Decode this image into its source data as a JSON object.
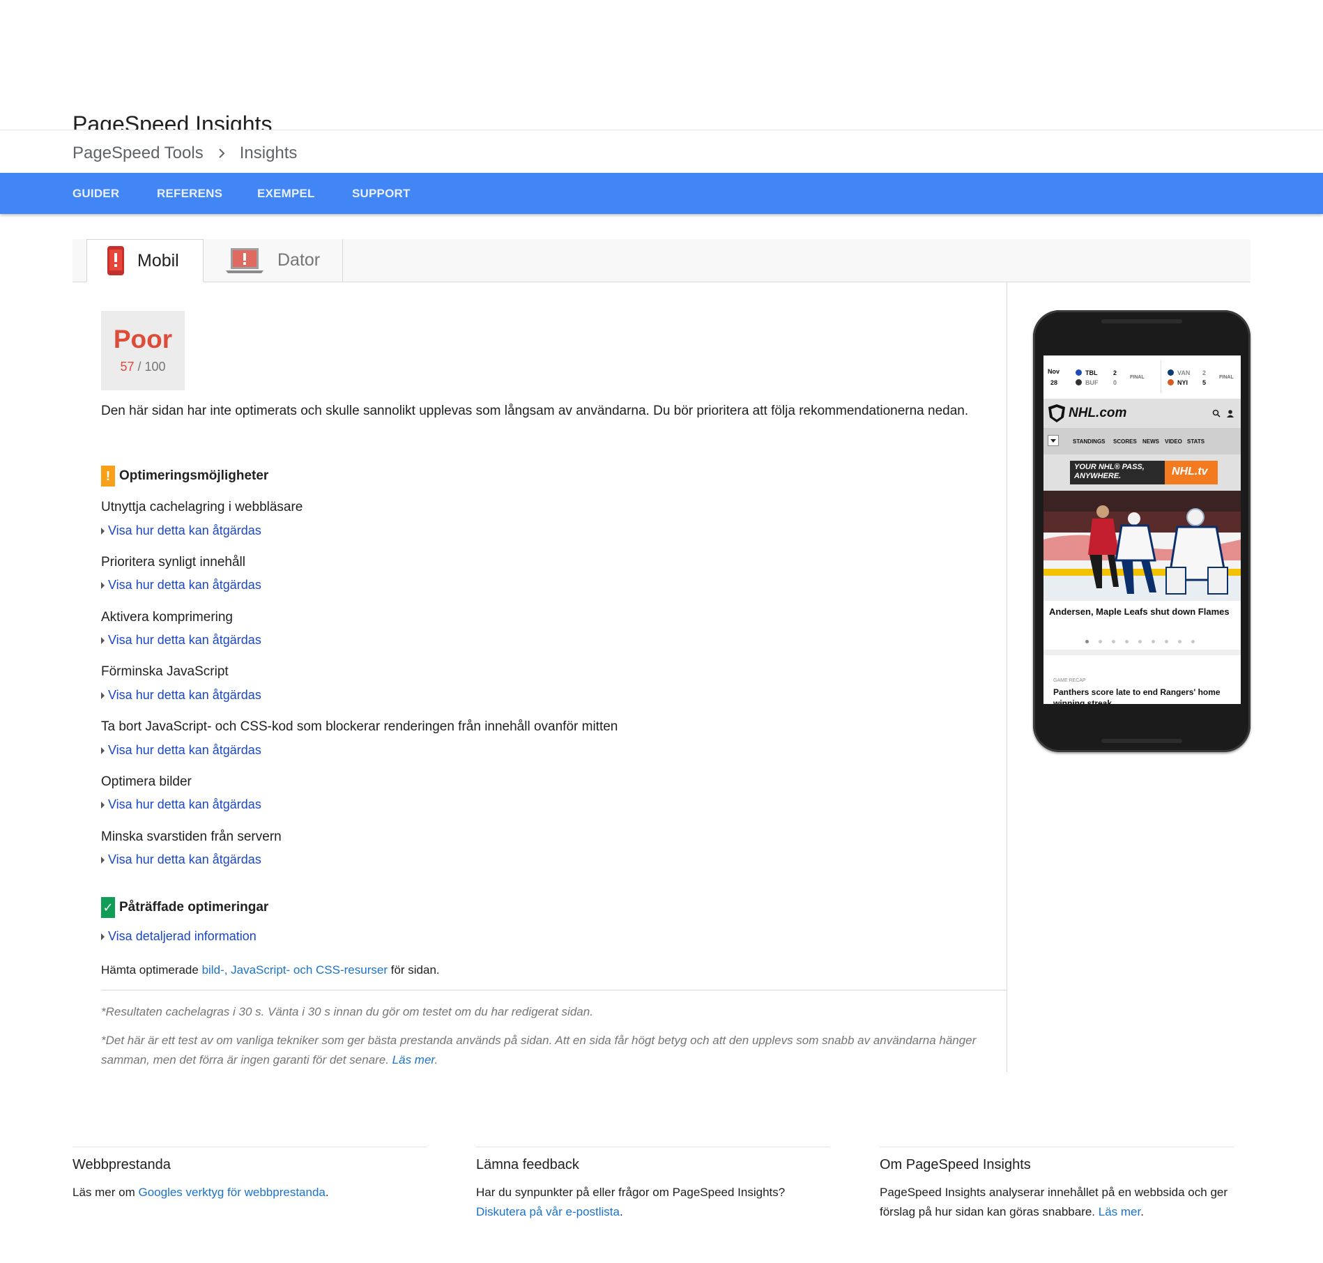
{
  "page_title": "PageSpeed Insights",
  "breadcrumb": {
    "items": [
      "PageSpeed Tools",
      "Insights"
    ]
  },
  "nav": {
    "items": [
      "GUIDER",
      "REFERENS",
      "EXEMPEL",
      "SUPPORT"
    ]
  },
  "tabs": {
    "mobile": "Mobil",
    "desktop": "Dator"
  },
  "score": {
    "rating": "Poor",
    "value": "57",
    "max": " / 100"
  },
  "summary": "Den här sidan har inte optimerats och skulle sannolikt upplevas som långsam av användarna. Du bör prioritera att följa rekommendationerna nedan.",
  "opportunities": {
    "heading": "Optimeringsmöjligheter",
    "items": [
      {
        "title": "Utnyttja cachelagring i webbläsare",
        "link": "Visa hur detta kan åtgärdas"
      },
      {
        "title": "Prioritera synligt innehåll",
        "link": "Visa hur detta kan åtgärdas"
      },
      {
        "title": "Aktivera komprimering",
        "link": "Visa hur detta kan åtgärdas"
      },
      {
        "title": "Förminska JavaScript",
        "link": "Visa hur detta kan åtgärdas"
      },
      {
        "title": "Ta bort JavaScript- och CSS-kod som blockerar renderingen från innehåll ovanför mitten",
        "link": "Visa hur detta kan åtgärdas"
      },
      {
        "title": "Optimera bilder",
        "link": "Visa hur detta kan åtgärdas"
      },
      {
        "title": "Minska svarstiden från servern",
        "link": "Visa hur detta kan åtgärdas"
      }
    ]
  },
  "passed": {
    "heading": "Påträffade optimeringar",
    "link": "Visa detaljerad information"
  },
  "download": {
    "prefix": "Hämta optimerade ",
    "link": "bild-, JavaScript- och CSS-resurser",
    "suffix": " för sidan."
  },
  "notes": {
    "cache": "*Resultaten cachelagras i 30 s. Vänta i 30 s innan du gör om testet om du har redigerat sidan.",
    "disclaimer": "*Det här är ett test av om vanliga tekniker som ger bästa prestanda används på sidan. Att en sida får högt betyg och att den upplevs som snabb av användarna hänger samman, men det förra är ingen garanti för det senare. ",
    "read_more": "Läs mer",
    "period": "."
  },
  "phone_preview": {
    "scores": {
      "date_month": "Nov",
      "date_day": "28",
      "game1": {
        "team1": "TBL",
        "score1": "2",
        "team2": "BUF",
        "score2": "0",
        "status": "FINAL"
      },
      "game2": {
        "team1": "VAN",
        "score1": "2",
        "team2": "NYI",
        "score2": "5",
        "status": "FINAL"
      }
    },
    "logo": "NHL.com",
    "menu": [
      "STANDINGS",
      "SCORES",
      "NEWS",
      "VIDEO",
      "STATS"
    ],
    "ad_text_1": "YOUR NHL® PASS,",
    "ad_text_2": "ANYWHERE.",
    "ad_brand": "NHL.tv",
    "headline": "Andersen, Maple Leafs shut down Flames",
    "recap_label": "GAME RECAP",
    "recap_title": "Panthers score late to end Rangers' home winning streak"
  },
  "footer": {
    "col1": {
      "title": "Webbprestanda",
      "prefix": "Läs mer om ",
      "link": "Googles verktyg för webbprestanda",
      "suffix": "."
    },
    "col2": {
      "title": "Lämna feedback",
      "text": "Har du synpunkter på eller frågor om PageSpeed Insights?",
      "link": "Diskutera på vår e-postlista",
      "suffix": "."
    },
    "col3": {
      "title": "Om PageSpeed Insights",
      "text": "PageSpeed Insights analyserar innehållet på en webbsida och ger förslag på hur sidan kan göras snabbare. ",
      "link": "Läs mer",
      "suffix": "."
    }
  },
  "colors": {
    "nav_blue": "#4285f4",
    "poor_red": "#dd4b39",
    "warn_orange": "#f9a01b",
    "ok_green": "#0f9d58",
    "link_blue": "#1a73c9"
  }
}
